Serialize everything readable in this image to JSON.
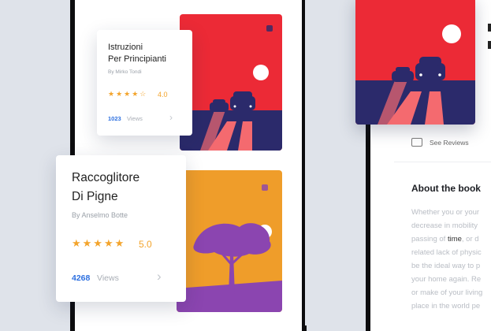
{
  "book1": {
    "title_line1": "Istruzioni",
    "title_line2": "Per Principianti",
    "author": "By Mirko Tondi",
    "stars": "★★★★☆",
    "rating": "4.0",
    "views_count": "1023",
    "views_label": "Views"
  },
  "book2": {
    "title_line1": "Raccoglitore",
    "title_line2": "Di Pigne",
    "author": "By Anselmo Botte",
    "stars": "★★★★★",
    "rating": "5.0",
    "views_count": "4268",
    "views_label": "Views"
  },
  "detail": {
    "see_reviews": "See Reviews",
    "about_title": "About the book",
    "about_lines": [
      "Whether you or your",
      "decrease in mobility",
      "passing of ",
      "related lack of physic",
      "be the ideal way to p",
      "your home again. Re",
      "or make of your living",
      "place in the world pe"
    ],
    "about_highlight": "time",
    "about_after_highlight": ", or d"
  },
  "colors": {
    "red": "#ec2a36",
    "navy": "#2b2a6b",
    "orange": "#ef9d2a",
    "purple": "#8b45b0",
    "accent_blue": "#2c6fe0",
    "star": "#f3a42c"
  }
}
